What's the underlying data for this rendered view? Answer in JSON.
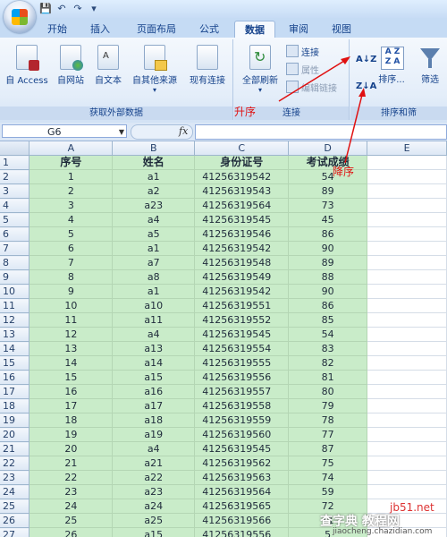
{
  "tabs": [
    "开始",
    "插入",
    "页面布局",
    "公式",
    "数据",
    "审阅",
    "视图"
  ],
  "active_tab": "数据",
  "ribbon": {
    "groups": {
      "external": {
        "label": "获取外部数据",
        "buttons": [
          "自 Access",
          "自网站",
          "自文本",
          "自其他来源",
          "现有连接"
        ]
      },
      "connections": {
        "label": "连接",
        "refresh_all": "全部刷新",
        "connections": "连接",
        "properties": "属性",
        "edit_links": "编辑链接"
      },
      "sort_filter": {
        "label": "排序和筛",
        "sort": "排序...",
        "filter": "筛选",
        "asc_glyph": "A↓Z",
        "desc_glyph": "Z↓A",
        "big_glyph": "A Z Z A"
      }
    }
  },
  "formula_bar": {
    "name_box": "G6",
    "fx": "fx",
    "value": ""
  },
  "columns": [
    "A",
    "B",
    "C",
    "D",
    "E"
  ],
  "headers": [
    "序号",
    "姓名",
    "身份证号",
    "考试成绩"
  ],
  "rows": [
    [
      "1",
      "a1",
      "41256319542",
      "54"
    ],
    [
      "2",
      "a2",
      "41256319543",
      "89"
    ],
    [
      "3",
      "a23",
      "41256319564",
      "73"
    ],
    [
      "4",
      "a4",
      "41256319545",
      "45"
    ],
    [
      "5",
      "a5",
      "41256319546",
      "86"
    ],
    [
      "6",
      "a1",
      "41256319542",
      "90"
    ],
    [
      "7",
      "a7",
      "41256319548",
      "89"
    ],
    [
      "8",
      "a8",
      "41256319549",
      "88"
    ],
    [
      "9",
      "a1",
      "41256319542",
      "90"
    ],
    [
      "10",
      "a10",
      "41256319551",
      "86"
    ],
    [
      "11",
      "a11",
      "41256319552",
      "85"
    ],
    [
      "12",
      "a4",
      "41256319545",
      "54"
    ],
    [
      "13",
      "a13",
      "41256319554",
      "83"
    ],
    [
      "14",
      "a14",
      "41256319555",
      "82"
    ],
    [
      "15",
      "a15",
      "41256319556",
      "81"
    ],
    [
      "16",
      "a16",
      "41256319557",
      "80"
    ],
    [
      "17",
      "a17",
      "41256319558",
      "79"
    ],
    [
      "18",
      "a18",
      "41256319559",
      "78"
    ],
    [
      "19",
      "a19",
      "41256319560",
      "77"
    ],
    [
      "20",
      "a4",
      "41256319545",
      "87"
    ],
    [
      "21",
      "a21",
      "41256319562",
      "75"
    ],
    [
      "22",
      "a22",
      "41256319563",
      "74"
    ],
    [
      "23",
      "a23",
      "41256319564",
      "59"
    ],
    [
      "24",
      "a24",
      "41256319565",
      "72"
    ],
    [
      "25",
      "a25",
      "41256319566",
      "71"
    ],
    [
      "26",
      "a15",
      "41256319556",
      "5"
    ]
  ],
  "annotations": {
    "ascending": "升序",
    "descending": "降序"
  },
  "watermark": {
    "site": "jb51.net",
    "brand": "查字典 教程网",
    "url": "jiaocheng.chazidian.com"
  },
  "colors": {
    "data_fill": "#c9ecc9",
    "annotation": "#e01010",
    "ribbon_text": "#15428b"
  }
}
